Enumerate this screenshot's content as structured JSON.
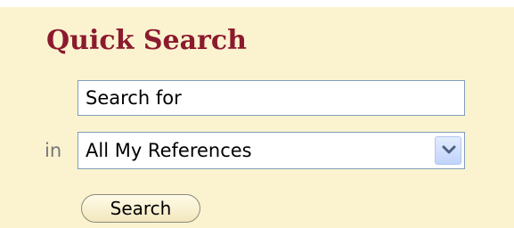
{
  "quick_search": {
    "title": "Quick Search",
    "search_input": {
      "value": "Search for",
      "placeholder": ""
    },
    "in_label": "in",
    "scope_select": {
      "selected": "All My References"
    },
    "search_button_label": "Search"
  },
  "icons": {
    "dropdown": "chevron-down-icon"
  },
  "colors": {
    "panel_background": "#fbf3d0",
    "title": "#8c1a2d",
    "input_border": "#7f9db9"
  }
}
